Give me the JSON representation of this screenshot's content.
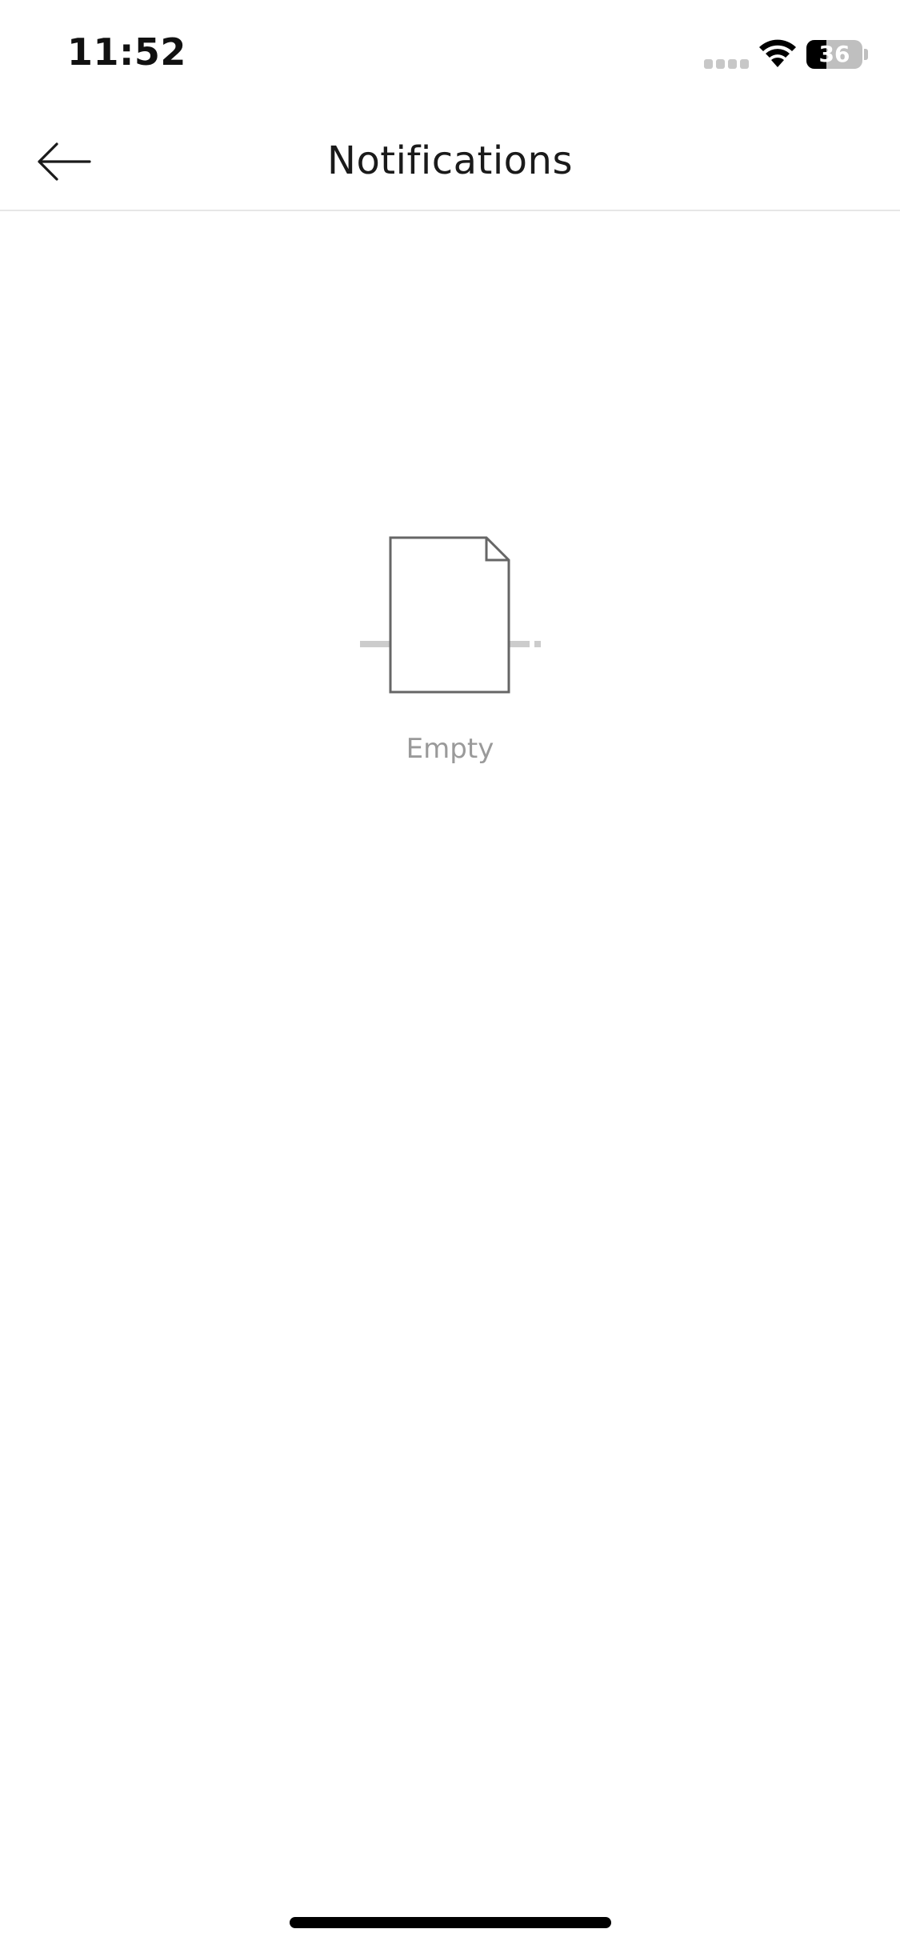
{
  "status_bar": {
    "time": "11:52",
    "battery_level": "36",
    "battery_percent": 36,
    "signal_icon": "cellular-signal-icon",
    "wifi_icon": "wifi-icon",
    "battery_icon": "battery-icon"
  },
  "header": {
    "title": "Notifications",
    "back_icon": "arrow-left-icon"
  },
  "empty_state": {
    "icon": "empty-document-icon",
    "label": "Empty"
  },
  "colors": {
    "background": "#ffffff",
    "title_text": "#1a1a1a",
    "muted_text": "#9a9a9a",
    "divider": "#e6e6e6",
    "icon_stroke": "#666666",
    "icon_accent": "#cccccc"
  }
}
